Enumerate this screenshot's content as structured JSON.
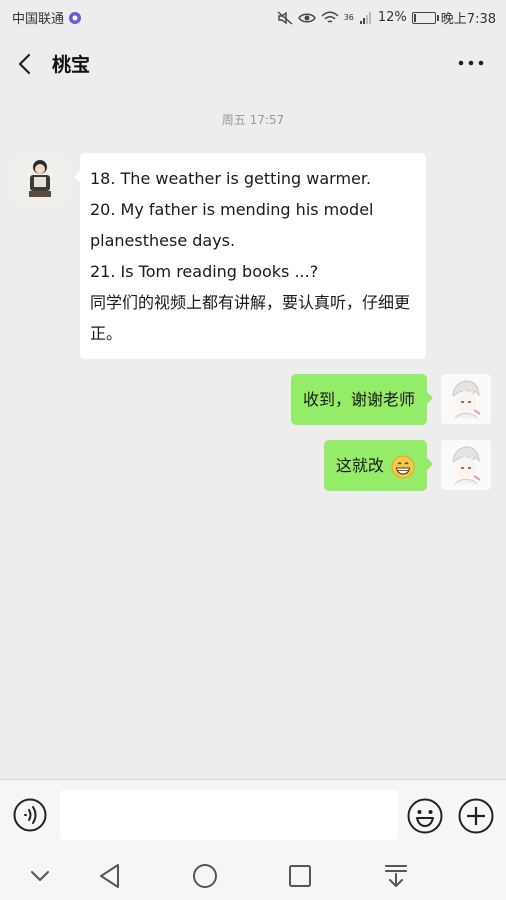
{
  "status_bar": {
    "carrier": "中国联通",
    "network": "36",
    "battery_text": "12%",
    "battery_level": 0.12,
    "time": "晚上7:38"
  },
  "header": {
    "title": "桃宝"
  },
  "chat": {
    "timestamp": "周五 17:57",
    "messages": [
      {
        "direction": "incoming",
        "lines": [
          "18. The weather is getting warmer.",
          "20. My father is mending his model planesthese days.",
          "21. Is Tom reading books ...?",
          "同学们的视频上都有讲解，要认真听，仔细更正。"
        ]
      },
      {
        "direction": "outgoing",
        "text": "收到，谢谢老师"
      },
      {
        "direction": "outgoing",
        "text": "这就改",
        "emoji": "grinning-face-icon"
      }
    ]
  },
  "input": {
    "placeholder": ""
  },
  "colors": {
    "background": "#ededed",
    "outgoing_bubble": "#95ec69",
    "incoming_bubble": "#ffffff"
  }
}
